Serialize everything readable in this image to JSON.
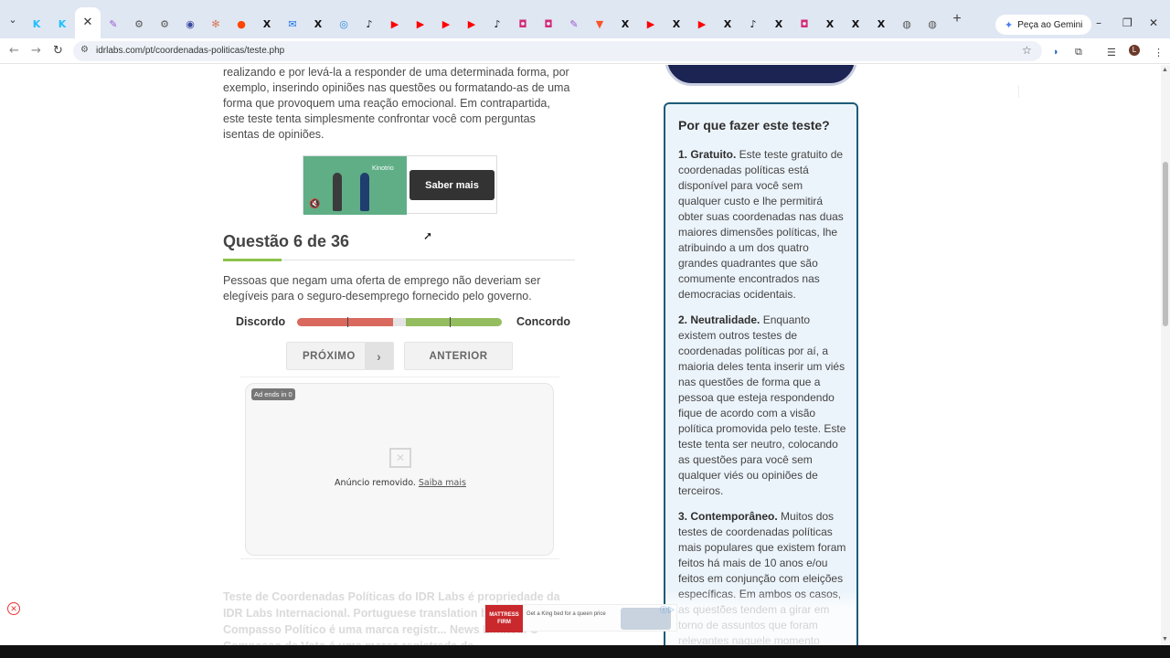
{
  "browser": {
    "tabs": [
      {
        "icon": "kaggle-icon",
        "color": "#20beff",
        "glyph": "K"
      },
      {
        "icon": "kaggle-icon",
        "color": "#20beff",
        "glyph": "K"
      },
      {
        "icon": "close-icon",
        "color": "#333333",
        "glyph": "✕"
      },
      {
        "icon": "pen-icon",
        "color": "#9b59d0",
        "glyph": "✎"
      },
      {
        "icon": "openai-icon",
        "color": "#555555",
        "glyph": "⚙"
      },
      {
        "icon": "openai-icon",
        "color": "#555555",
        "glyph": "⚙"
      },
      {
        "icon": "circle-icon",
        "color": "#3b4aa0",
        "glyph": "◉"
      },
      {
        "icon": "claude-icon",
        "color": "#d9775a",
        "glyph": "✻"
      },
      {
        "icon": "reddit-icon",
        "color": "#ff4500",
        "glyph": "●"
      },
      {
        "icon": "x-icon",
        "color": "#111111",
        "glyph": "X"
      },
      {
        "icon": "mail-icon",
        "color": "#1a73e8",
        "glyph": "✉"
      },
      {
        "icon": "x-icon",
        "color": "#111111",
        "glyph": "X"
      },
      {
        "icon": "copilot-icon",
        "color": "#2b88d8",
        "glyph": "◎"
      },
      {
        "icon": "tiktok-icon",
        "color": "#111111",
        "glyph": "♪"
      },
      {
        "icon": "youtube-icon",
        "color": "#ff0000",
        "glyph": "▶"
      },
      {
        "icon": "youtube-icon",
        "color": "#ff0000",
        "glyph": "▶"
      },
      {
        "icon": "youtube-icon",
        "color": "#ff0000",
        "glyph": "▶"
      },
      {
        "icon": "youtube-icon",
        "color": "#ff0000",
        "glyph": "▶"
      },
      {
        "icon": "tiktok-icon",
        "color": "#111111",
        "glyph": "♪"
      },
      {
        "icon": "instagram-icon",
        "color": "#d62976",
        "glyph": "◘"
      },
      {
        "icon": "instagram-icon",
        "color": "#d62976",
        "glyph": "◘"
      },
      {
        "icon": "pen-icon",
        "color": "#9b59d0",
        "glyph": "✎"
      },
      {
        "icon": "brave-icon",
        "color": "#fb542b",
        "glyph": "▼"
      },
      {
        "icon": "x-icon",
        "color": "#111111",
        "glyph": "X"
      },
      {
        "icon": "youtube-icon",
        "color": "#ff0000",
        "glyph": "▶"
      },
      {
        "icon": "x-icon",
        "color": "#111111",
        "glyph": "X"
      },
      {
        "icon": "youtube-icon",
        "color": "#ff0000",
        "glyph": "▶"
      },
      {
        "icon": "x-icon",
        "color": "#111111",
        "glyph": "X"
      },
      {
        "icon": "tiktok-icon",
        "color": "#111111",
        "glyph": "♪"
      },
      {
        "icon": "x-icon",
        "color": "#111111",
        "glyph": "X"
      },
      {
        "icon": "instagram-icon",
        "color": "#d62976",
        "glyph": "◘"
      },
      {
        "icon": "x-icon",
        "color": "#111111",
        "glyph": "X"
      },
      {
        "icon": "x-icon",
        "color": "#111111",
        "glyph": "X"
      },
      {
        "icon": "x-icon",
        "color": "#111111",
        "glyph": "X"
      },
      {
        "icon": "chrome-icon",
        "color": "#555555",
        "glyph": "◍"
      },
      {
        "icon": "chrome-icon",
        "color": "#555555",
        "glyph": "◍"
      }
    ],
    "gemini_label": "Peça ao Gemini",
    "url": "idrlabs.com/pt/coordenadas-politicas/teste.php",
    "profile_initial": "L"
  },
  "content": {
    "intro": "realizando e por levá-la a responder de uma determinada forma, por exemplo, inserindo opiniões nas questões ou formatando-as de uma forma que provoquem uma reação emocional. Em contrapartida, este teste tenta simplesmente confrontar você com perguntas isentas de opiniões.",
    "ad_top": {
      "brand": "Kinotrio",
      "button": "Saber mais"
    },
    "question_title": "Questão 6 de 36",
    "question_text": "Pessoas que negam uma oferta de emprego não deveriam ser elegíveis para o seguro-desemprego fornecido pelo governo.",
    "scale": {
      "left_label": "Discordo",
      "right_label": "Concordo",
      "left_color": "#d9685d",
      "right_color": "#94bd5f"
    },
    "buttons": {
      "next": "PRÓXIMO",
      "previous": "ANTERIOR"
    },
    "ad_removed": {
      "ends": "Ad ends in 0",
      "message": "Anúncio removido.",
      "link": "Saiba mais"
    },
    "footer": "Teste de Coordenadas Políticas do IDR Labs é propriedade da IDR Labs Internacional. Portuguese translation by Sa... Teste de Compasso Político é uma marca registr... News Limited. O Compasso de Voto é uma marca registrada de"
  },
  "bottom_ad": {
    "brand": "MATTRESS FIRM",
    "text": "Get a King bed for a queen price"
  },
  "sidebar": {
    "title": "Por que fazer este teste?",
    "points": [
      {
        "heading": "1. Gratuito.",
        "text": " Este teste gratuito de coordenadas políticas está disponível para você sem qualquer custo e lhe permitirá obter suas coordenadas nas duas maiores dimensões políticas, lhe atribuindo a um dos quatro grandes quadrantes que são comumente encontrados nas democracias ocidentais."
      },
      {
        "heading": "2. Neutralidade.",
        "text": " Enquanto existem outros testes de coordenadas políticas por aí, a maioria deles tenta inserir um viés nas questões de forma que a pessoa que esteja respondendo fique de acordo com a visão política promovida pelo teste. Este teste tenta ser neutro, colocando as questões para você sem qualquer viés ou opiniões de terceiros."
      },
      {
        "heading": "3. Contemporâneo.",
        "text": " Muitos dos testes de coordenadas políticas mais populares que existem foram feitos há mais de 10 anos e/ou feitos em conjunção com eleições específicas. Em ambos os casos, as questões tendem a girar em torno de assuntos que foram relevantes naquele momento"
      }
    ]
  }
}
